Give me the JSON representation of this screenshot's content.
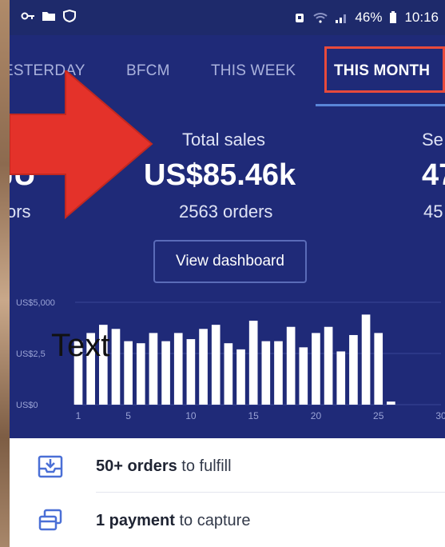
{
  "statusbar": {
    "battery": "46%",
    "time": "10:16"
  },
  "tabs": [
    {
      "label": "ESTERDAY",
      "active": false
    },
    {
      "label": "BFCM",
      "active": false
    },
    {
      "label": "THIS WEEK",
      "active": false
    },
    {
      "label": "THIS MONTH",
      "active": true
    }
  ],
  "metrics": {
    "left": {
      "value": "JU",
      "sub": "ors"
    },
    "center": {
      "label": "Total sales",
      "value": "US$85.46k",
      "sub": "2563 orders"
    },
    "right": {
      "label": "Se",
      "value": "47",
      "sub": "45"
    }
  },
  "dashboard_button": "View dashboard",
  "overlay_text": "Text",
  "chart_data": {
    "type": "bar",
    "x": [
      1,
      2,
      3,
      4,
      5,
      6,
      7,
      8,
      9,
      10,
      11,
      12,
      13,
      14,
      15,
      16,
      17,
      18,
      19,
      20,
      21,
      22,
      23,
      24,
      25,
      26
    ],
    "values": [
      3100,
      3500,
      3900,
      3700,
      3100,
      3000,
      3500,
      3100,
      3500,
      3200,
      3700,
      3900,
      3000,
      2700,
      4100,
      3100,
      3100,
      3800,
      2800,
      3500,
      3800,
      2600,
      3400,
      4400,
      3500,
      150
    ],
    "ytick_labels": [
      "US$0",
      "US$2,5",
      "US$5,000"
    ],
    "yticks": [
      0,
      2500,
      5000
    ],
    "xtick_labels": [
      "1",
      "5",
      "10",
      "15",
      "20",
      "25",
      "30"
    ],
    "xticks": [
      1,
      5,
      10,
      15,
      20,
      25,
      30
    ],
    "ylim": [
      0,
      5000
    ],
    "xlim": [
      1,
      30
    ],
    "bar_color": "#ffffff",
    "grid": true
  },
  "tasks": [
    {
      "bold": "50+ orders",
      "rest": " to fulfill",
      "icon": "download-box-icon"
    },
    {
      "bold": "1 payment",
      "rest": " to capture",
      "icon": "cards-icon"
    }
  ],
  "colors": {
    "panel": "#1f2a78",
    "accent_red": "#e84a3c",
    "underline": "#5a86d8",
    "icon_blue": "#4a6fd6"
  }
}
